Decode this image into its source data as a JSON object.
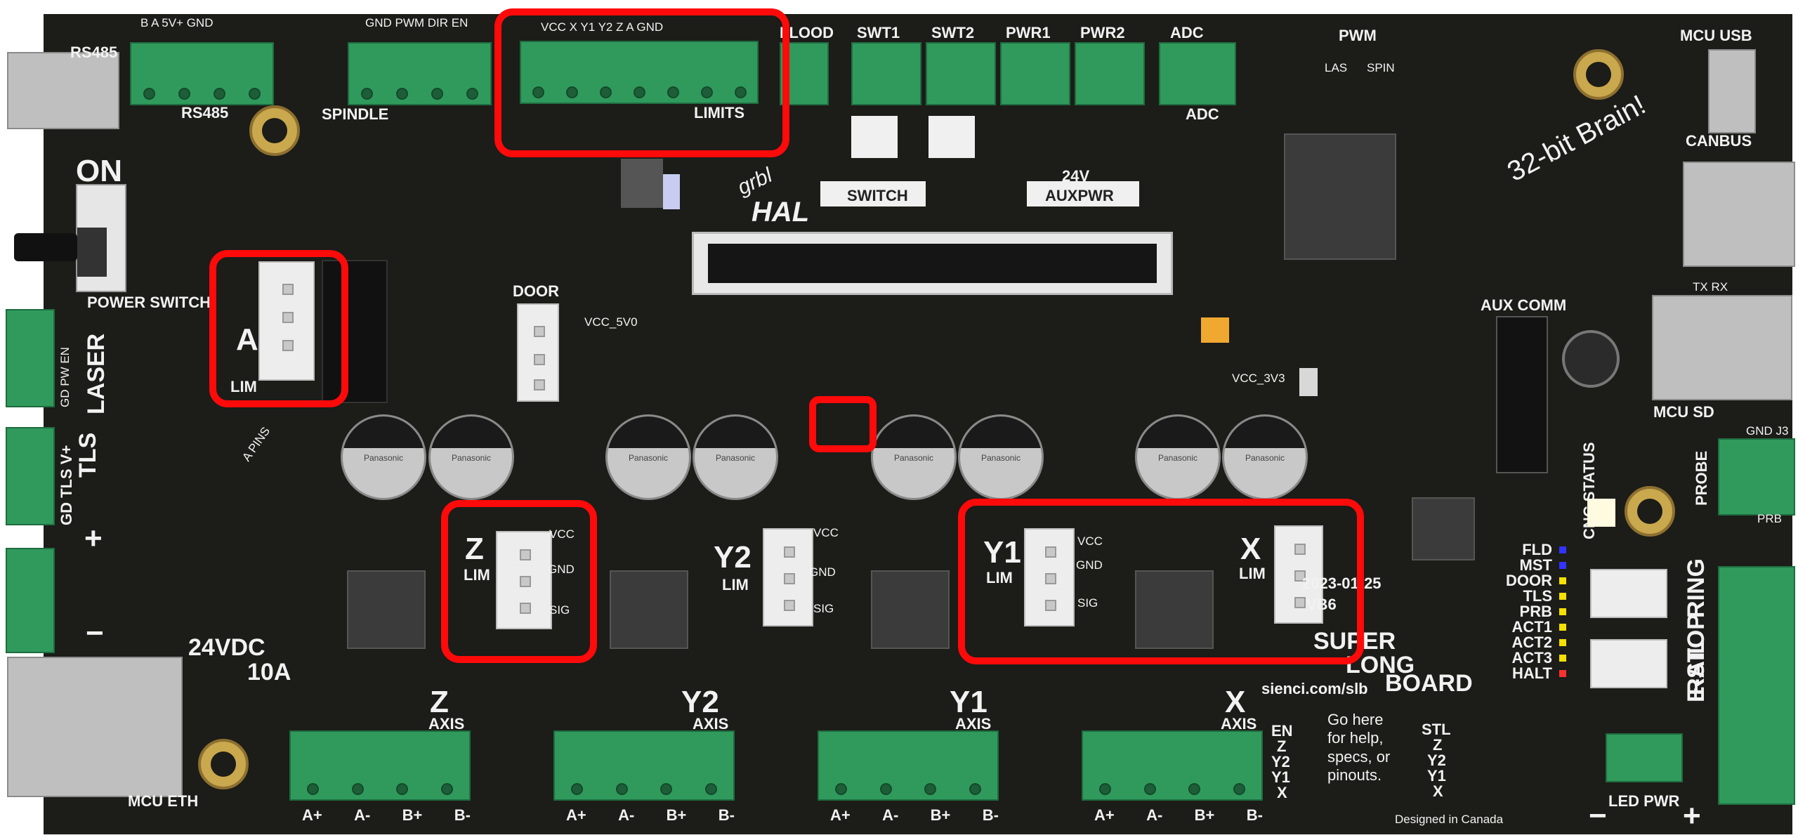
{
  "board": {
    "brand_line1": "grbl",
    "brand_line2": "HAL",
    "slogan": "32-bit Brain!",
    "model_super": "SUPER",
    "model_long": "LONG",
    "model_board": "BOARD",
    "date_code": "2023-01-25",
    "rev_code": "VB6",
    "url": "sienci.com/slb",
    "help_text": "Go here for help, specs, or pinouts.",
    "footer": "Designed in Canada"
  },
  "connectors": {
    "rs485_top": "RS485",
    "rs485_pins": "B A 5V+ GND",
    "rs485_label": "RS485",
    "spindle_pins": "GND PWM DIR EN",
    "spindle_label": "SPINDLE",
    "limits_pins": "VCC X Y1 Y2 Z A GND",
    "limits_label": "LIMITS",
    "flood_label": "FLOOD",
    "swt1": "SWT1",
    "swt2": "SWT2",
    "pwr1": "PWR1",
    "pwr2": "PWR2",
    "adc": "ADC",
    "adc_bottom": "ADC",
    "mcu_usb": "MCU USB",
    "canbus": "CANBUS",
    "power_switch": "POWER SWITCH",
    "on": "ON",
    "laser": "LASER",
    "laser_pins": "GD PW EN",
    "tls": "TLS",
    "tls_pins": "GD TLS V+",
    "door": "DOOR",
    "vcc_5v0": "VCC_5V0",
    "vcc_3v3": "VCC_3V3",
    "aux_comm": "AUX COMM",
    "mcu_sd": "MCU SD",
    "txrx": "TX RX",
    "probe": "PROBE",
    "prb": "PRB",
    "gnd_j3": "GND J3",
    "cnc_status": "CNC STATUS",
    "ring": "RING",
    "rail": "RAIL",
    "e_stop": "E-STOP",
    "led_pwr": "LED PWR",
    "pwm": "PWM",
    "las": "LAS",
    "spin": "SPIN",
    "mcu_eth": "MCU ETH",
    "vdc": "24VDC",
    "amps": "10A",
    "switch_lbl": "SWITCH",
    "auxpwr_lbl": "AUXPWR",
    "v24": "24V",
    "a_pins": "A PINS",
    "en": "EN",
    "lim": "LIM"
  },
  "axes": [
    {
      "letter": "Z",
      "lim": "LIM",
      "bottom": "Z",
      "bottom_sub": "AXIS"
    },
    {
      "letter": "Y2",
      "lim": "LIM",
      "bottom": "Y2",
      "bottom_sub": "AXIS"
    },
    {
      "letter": "Y1",
      "lim": "LIM",
      "bottom": "Y1",
      "bottom_sub": "AXIS"
    },
    {
      "letter": "X",
      "lim": "LIM",
      "bottom": "X",
      "bottom_sub": "AXIS"
    },
    {
      "letter": "A",
      "lim": "LIM"
    }
  ],
  "signals": {
    "vcc": "VCC",
    "gnd": "GND",
    "sig": "SIG"
  },
  "motor_pins": [
    "A+",
    "A-",
    "B+",
    "B-"
  ],
  "status_leds": [
    "FLD",
    "MST",
    "DOOR",
    "TLS",
    "PRB",
    "ACT1",
    "ACT2",
    "ACT3",
    "HALT"
  ],
  "legend_b": [
    "EN",
    "Z",
    "Y2",
    "Y1",
    "X"
  ],
  "legend_a": [
    "STL",
    "Z",
    "Y2",
    "Y1",
    "X"
  ],
  "cap_brand": "Panasonic",
  "colors": {
    "pcb": "#1c1c18",
    "terminal": "#2f9a5c",
    "highlight": "#ff0a0a",
    "silk": "#f2f2f2"
  }
}
